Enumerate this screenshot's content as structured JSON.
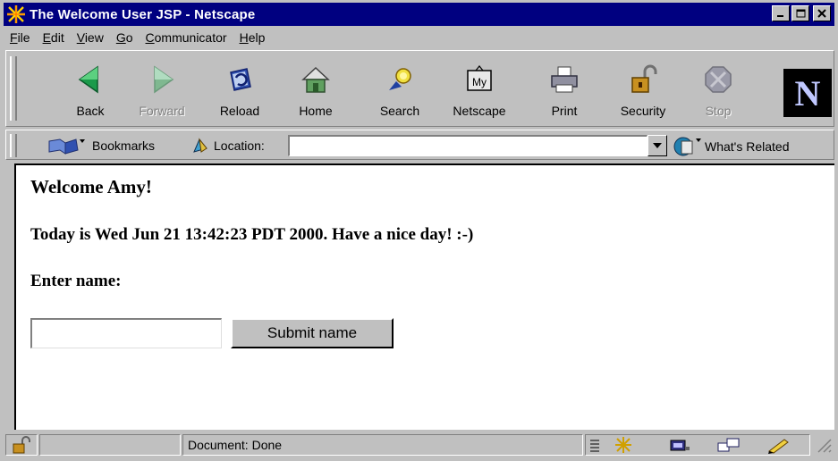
{
  "window": {
    "title": "The Welcome User JSP - Netscape",
    "controls": {
      "minimize": "_",
      "maximize": "□",
      "close": "✕"
    }
  },
  "menu": [
    {
      "label": "File",
      "key": "F",
      "rest": "ile"
    },
    {
      "label": "Edit",
      "key": "E",
      "rest": "dit"
    },
    {
      "label": "View",
      "key": "V",
      "rest": "iew"
    },
    {
      "label": "Go",
      "key": "G",
      "rest": "o"
    },
    {
      "label": "Communicator",
      "key": "C",
      "rest": "ommunicator"
    },
    {
      "label": "Help",
      "key": "H",
      "rest": "elp"
    }
  ],
  "toolbar": {
    "buttons": [
      {
        "label": "Back",
        "icon": "back-arrow-icon",
        "enabled": true
      },
      {
        "label": "Forward",
        "icon": "forward-arrow-icon",
        "enabled": false
      },
      {
        "label": "Reload",
        "icon": "reload-icon",
        "enabled": true
      },
      {
        "label": "Home",
        "icon": "home-icon",
        "enabled": true
      },
      {
        "label": "Search",
        "icon": "search-icon",
        "enabled": true
      },
      {
        "label": "Netscape",
        "icon": "my-netscape-icon",
        "enabled": true
      },
      {
        "label": "Print",
        "icon": "printer-icon",
        "enabled": true
      },
      {
        "label": "Security",
        "icon": "padlock-icon",
        "enabled": true
      },
      {
        "label": "Stop",
        "icon": "stop-icon",
        "enabled": false
      }
    ],
    "logo_letter": "N"
  },
  "location_bar": {
    "bookmarks_label": "Bookmarks",
    "location_label": "Location:",
    "location_value": "",
    "whats_related_label": "What's Related"
  },
  "content": {
    "heading": "Welcome Amy!",
    "date_line": "Today is Wed Jun 21 13:42:23 PDT 2000. Have a nice day! :-)",
    "prompt": "Enter name:",
    "name_input_value": "",
    "submit_label": "Submit name"
  },
  "status": {
    "text": "Document: Done"
  },
  "colors": {
    "titlebar": "#000080",
    "chrome": "#c0c0c0",
    "content_bg": "#ffffff"
  }
}
